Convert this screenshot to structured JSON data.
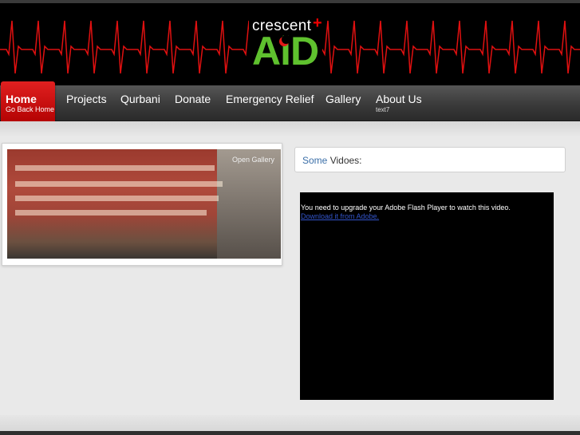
{
  "logo": {
    "top_text": "crescent",
    "main_text": "AiD",
    "cross": "+"
  },
  "nav": {
    "home": {
      "label": "Home",
      "sub": "Go Back Home"
    },
    "items": [
      {
        "label": "Projects",
        "sub": ""
      },
      {
        "label": "Qurbani",
        "sub": ""
      },
      {
        "label": "Donate",
        "sub": ""
      },
      {
        "label": "Emergency Relief",
        "sub": ""
      },
      {
        "label": "Gallery",
        "sub": ""
      },
      {
        "label": "About Us",
        "sub": "text7"
      }
    ]
  },
  "gallery": {
    "open_label": "Open Gallery"
  },
  "videos": {
    "title_accent": "Some",
    "title_rest": " Vidoes:",
    "flash_message": "You need to upgrade your Adobe Flash Player to watch this video.",
    "download_link": "Download it from Adobe."
  },
  "colors": {
    "nav_active": "#d01010",
    "logo_green": "#5fc12e",
    "ecg_red": "#e01010"
  }
}
